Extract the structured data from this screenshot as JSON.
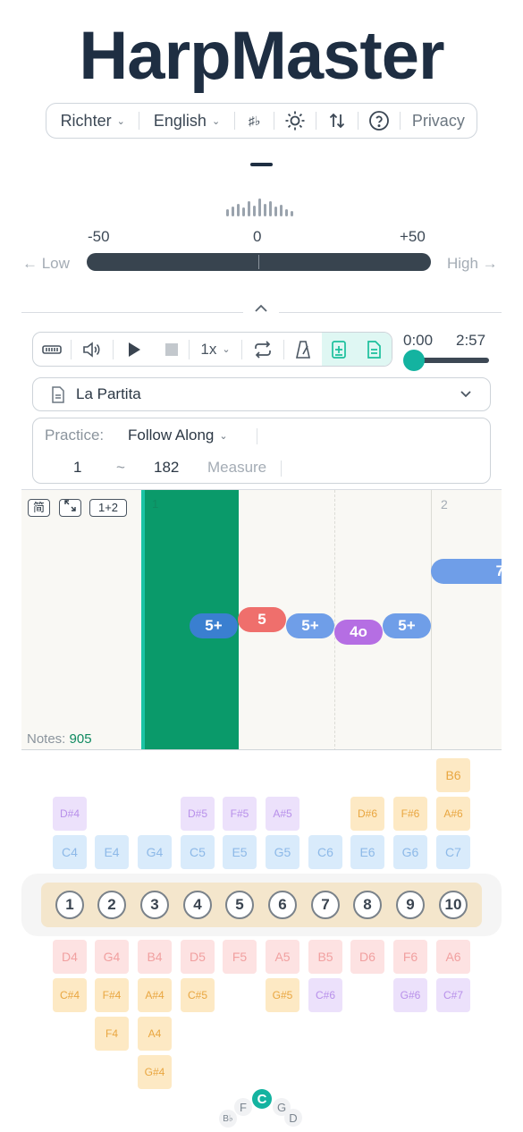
{
  "app": {
    "title": "HarpMaster"
  },
  "topbar": {
    "tuning": "Richter",
    "language": "English",
    "accidental_label": "♯♭",
    "privacy": "Privacy"
  },
  "tuner": {
    "scale_min": "-50",
    "scale_mid": "0",
    "scale_max": "+50",
    "low_label": "← Low",
    "high_label": "High →"
  },
  "player": {
    "speed": "1x",
    "current_time": "0:00",
    "total_time": "2:57",
    "progress": 0.0
  },
  "song": {
    "name": "La Partita"
  },
  "practice": {
    "label": "Practice:",
    "mode": "Follow Along",
    "measure_from": "1",
    "range_sep": "~",
    "measure_to": "182",
    "measure_label": "Measure"
  },
  "roll": {
    "btn_simplified": "简",
    "btn_layout": "1+2",
    "measure_1": "1",
    "measure_2": "2",
    "notes_label": "Notes:",
    "notes_count": "905",
    "notes": [
      {
        "label": "5+",
        "color": "#3a7fd0"
      },
      {
        "label": "5",
        "color": "#ef6f6c"
      },
      {
        "label": "5+",
        "color": "#6f9ee8"
      },
      {
        "label": "4o",
        "color": "#b56ee3"
      },
      {
        "label": "5+",
        "color": "#6f9ee8"
      },
      {
        "label": "7",
        "color": "#6f9ee8"
      }
    ]
  },
  "harmonica": {
    "holes": [
      "1",
      "2",
      "3",
      "4",
      "5",
      "6",
      "7",
      "8",
      "9",
      "10"
    ],
    "blow": [
      "C4",
      "E4",
      "G4",
      "C5",
      "E5",
      "G5",
      "C6",
      "E6",
      "G6",
      "C7"
    ],
    "draw": [
      "D4",
      "G4",
      "B4",
      "D5",
      "F5",
      "A5",
      "B5",
      "D6",
      "F6",
      "A6"
    ],
    "blow_bends_1": [
      "D#4",
      "",
      "",
      "D#5",
      "F#5",
      "A#5",
      "",
      "D#6",
      "F#6",
      "A#6"
    ],
    "blow_bends_2": [
      "",
      "",
      "",
      "",
      "",
      "",
      "",
      "",
      "",
      "B6"
    ],
    "draw_bends_1": [
      "C#4",
      "F#4",
      "A#4",
      "C#5",
      "",
      "G#5",
      "C#6",
      "",
      "G#6",
      "C#7"
    ],
    "draw_bends_2": [
      "",
      "F4",
      "A4",
      "",
      "",
      "",
      "",
      "",
      "",
      ""
    ],
    "draw_bends_3": [
      "",
      "",
      "G#4",
      "",
      "",
      "",
      "",
      "",
      "",
      ""
    ]
  },
  "key_wheel": {
    "selected": "C",
    "keys": [
      "F",
      "C",
      "G",
      "B♭",
      "D"
    ]
  },
  "colors": {
    "accent": "#14b3a0",
    "playhead": "#0a9a6a"
  }
}
